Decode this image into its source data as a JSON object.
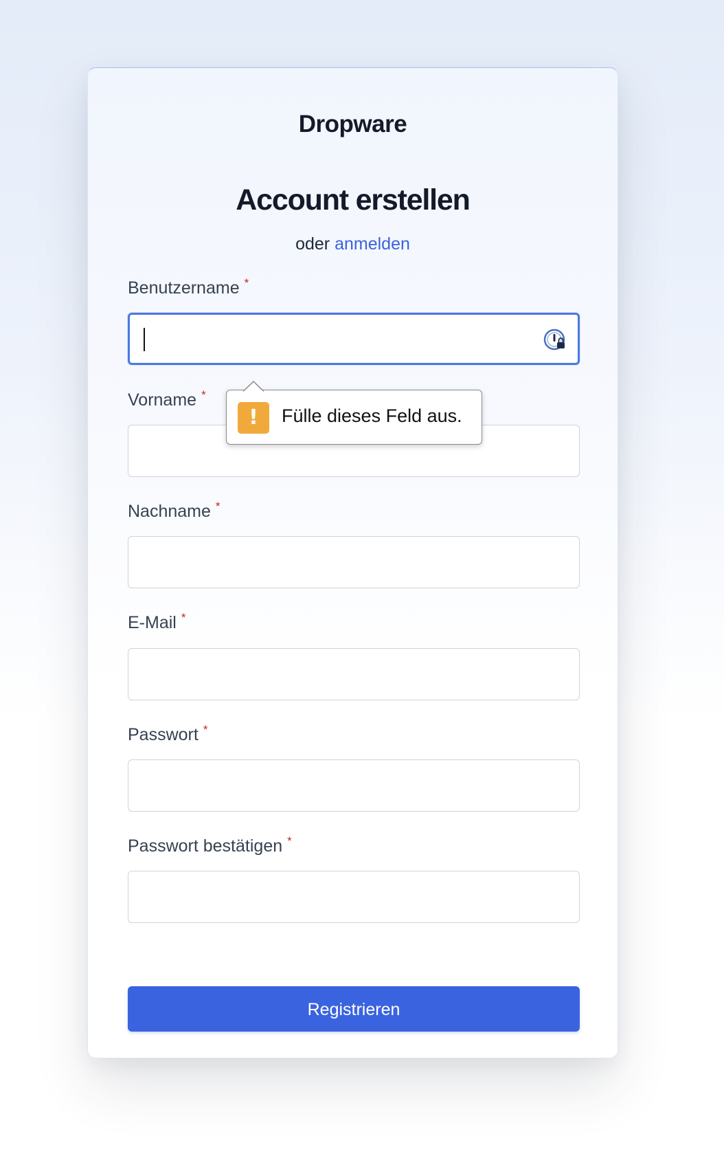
{
  "brand": "Dropware",
  "title": "Account erstellen",
  "subtitle": {
    "prefix": "oder",
    "link": "anmelden"
  },
  "fields": [
    {
      "label": "Benutzername",
      "required_mark": "*",
      "value": ""
    },
    {
      "label": "Vorname",
      "required_mark": "*",
      "value": ""
    },
    {
      "label": "Nachname",
      "required_mark": "*",
      "value": ""
    },
    {
      "label": "E-Mail",
      "required_mark": "*",
      "value": ""
    },
    {
      "label": "Passwort",
      "required_mark": "*",
      "value": ""
    },
    {
      "label": "Passwort bestätigen",
      "required_mark": "*",
      "value": ""
    }
  ],
  "validation_tooltip": {
    "icon": "!",
    "message": "Fülle dieses Feld aus."
  },
  "submit_label": "Registrieren",
  "colors": {
    "accent": "#3a63e0",
    "link": "#3a63dc",
    "required": "#c0262d",
    "warning": "#f2a93b"
  }
}
